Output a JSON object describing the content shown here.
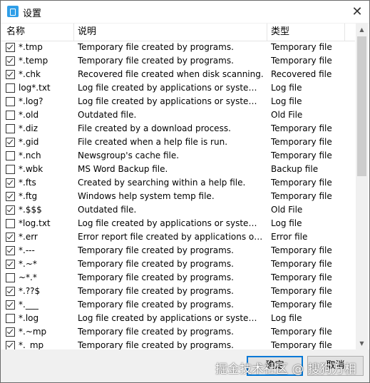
{
  "window": {
    "title": "设置"
  },
  "columns": {
    "name": "名称",
    "description": "说明",
    "type": "类型"
  },
  "rows": [
    {
      "checked": true,
      "name": "*.tmp",
      "description": "Temporary file created by programs.",
      "type": "Temporary file"
    },
    {
      "checked": true,
      "name": "*.temp",
      "description": "Temporary file created by programs.",
      "type": "Temporary file"
    },
    {
      "checked": true,
      "name": "*.chk",
      "description": "Recovered file created when disk scanning.",
      "type": "Recovered file"
    },
    {
      "checked": false,
      "name": "log*.txt",
      "description": "Log file created by applications or system servi...",
      "type": "Log file"
    },
    {
      "checked": false,
      "name": "*.log?",
      "description": "Log file created by applications or system servi...",
      "type": "Log file"
    },
    {
      "checked": false,
      "name": "*.old",
      "description": "Outdated file.",
      "type": "Old File"
    },
    {
      "checked": false,
      "name": "*.diz",
      "description": "File created by a download process.",
      "type": "Temporary file"
    },
    {
      "checked": true,
      "name": "*.gid",
      "description": "File created when a help file is run.",
      "type": "Temporary file"
    },
    {
      "checked": false,
      "name": "*.nch",
      "description": "Newsgroup's cache file.",
      "type": "Temporary file"
    },
    {
      "checked": false,
      "name": "*.wbk",
      "description": "MS Word Backup file.",
      "type": "Backup file"
    },
    {
      "checked": true,
      "name": "*.fts",
      "description": "Created by searching within a help file.",
      "type": "Temporary file"
    },
    {
      "checked": true,
      "name": "*.ftg",
      "description": "Windows help system temp file.",
      "type": "Temporary file"
    },
    {
      "checked": true,
      "name": "*.$$$",
      "description": "Outdated file.",
      "type": "Old File"
    },
    {
      "checked": false,
      "name": "*log.txt",
      "description": "Log file created by applications or system servi...",
      "type": "Log file"
    },
    {
      "checked": true,
      "name": "*.err",
      "description": "Error report file created by applications or syste...",
      "type": "Error file"
    },
    {
      "checked": true,
      "name": "*.---",
      "description": "Temporary file created by programs.",
      "type": "Temporary file"
    },
    {
      "checked": true,
      "name": "*.~*",
      "description": "Temporary file created by programs.",
      "type": "Temporary file"
    },
    {
      "checked": false,
      "name": "~*.*",
      "description": "Temporary file created by programs.",
      "type": "Temporary file"
    },
    {
      "checked": true,
      "name": "*.??$",
      "description": "Temporary file created by programs.",
      "type": "Temporary file"
    },
    {
      "checked": true,
      "name": "*.___",
      "description": "Temporary file created by programs.",
      "type": "Temporary file"
    },
    {
      "checked": false,
      "name": "*.log",
      "description": "Log file created by applications or system servi...",
      "type": "Log file"
    },
    {
      "checked": true,
      "name": "*.~mp",
      "description": "Temporary file created by programs.",
      "type": "Temporary file"
    },
    {
      "checked": true,
      "name": "*._mp",
      "description": "Temporary file created by programs.",
      "type": "Temporary file"
    }
  ],
  "buttons": {
    "ok": "确定",
    "cancel": "取消"
  },
  "watermark": "掘金技术社区 @ 搜狗万相"
}
